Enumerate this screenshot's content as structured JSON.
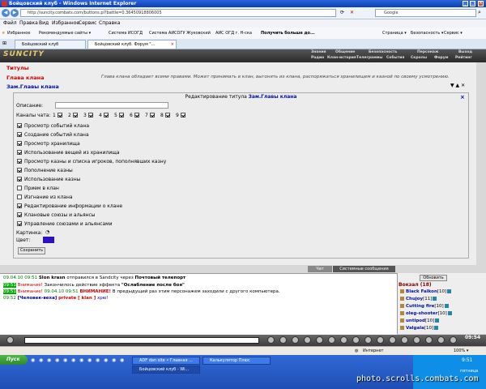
{
  "window": {
    "title": "Бойцовский клуб - Windows Internet Explorer"
  },
  "address": {
    "url": "http://suncity.combats.com/buttons.pl?battle=0.36450918806005",
    "search_engine": "Google"
  },
  "menu": [
    "Файл",
    "Правка",
    "Вид",
    "Избранное",
    "Сервис",
    "Справка"
  ],
  "favorites": [
    "Избранное",
    "Рекомендуемые сайты ▾",
    "Система ИСОГД",
    "Система АИСОГУ Жуковский",
    "АИС ОГД г. Н-ска",
    "Получить больше до..."
  ],
  "ie_tools": [
    "Страница ▾",
    "Безопасность ▾",
    "Сервис ▾"
  ],
  "tabs": [
    {
      "label": "Бойцовский клуб"
    },
    {
      "label": "Бойцовский клуб. Форум \"..."
    }
  ],
  "game": {
    "logo": "SUNCITY",
    "nav_top": [
      "Знания",
      "Общение",
      "Безопасность",
      "Персонаж",
      "Выход"
    ],
    "nav_bottom": [
      "Радио",
      "Клан-история",
      "Телеграммы",
      "События",
      "Скролы",
      "Форум",
      "Рейтинг"
    ]
  },
  "titles": {
    "section": "Титулы",
    "head_label": "Глава клана",
    "head_desc": "Глава клана обладает всеми правами. Может принимать в клан, выгонять из клана, распоряжаться хранилищем и казной по своему усмотрению.",
    "deputy_label": "Зам.Главы клана"
  },
  "editor": {
    "title_prefix": "Редактирование титула",
    "title_name": "Зам.Главы клана",
    "description_label": "Описание:",
    "channels_label": "Каналы чата:",
    "channels": [
      "1",
      "2",
      "3",
      "4",
      "5",
      "6",
      "7",
      "8",
      "9"
    ],
    "permissions": [
      {
        "label": "Просмотр событий клана",
        "checked": true
      },
      {
        "label": "Создание событий клана",
        "checked": true
      },
      {
        "label": "Просмотр хранилища",
        "checked": true
      },
      {
        "label": "Использование вещей из хранилища",
        "checked": true
      },
      {
        "label": "Просмотр казны и списка игроков, пополнявших казну",
        "checked": true
      },
      {
        "label": "Пополнение казны",
        "checked": true
      },
      {
        "label": "Использование казны",
        "checked": true
      },
      {
        "label": "Прием в клан",
        "checked": false
      },
      {
        "label": "Изгнание из клана",
        "checked": false
      },
      {
        "label": "Редактирование информации о клане",
        "checked": true
      },
      {
        "label": "Клановые союзы и альянсы",
        "checked": true
      },
      {
        "label": "Управление союзами и альянсами",
        "checked": true
      }
    ],
    "image_label": "Картинка:",
    "color_label": "Цвет:",
    "color_value": "#2c10c8",
    "save_label": "Сохранить"
  },
  "chat_tabs": [
    "Чат",
    "Системные сообщения"
  ],
  "chat": {
    "l1_time": "09.04.10 09:51",
    "l1_name": "Slon krasn",
    "l1_text1": "отправился в",
    "l1_city": "Sandcity",
    "l1_text2": "через",
    "l1_what": "Почтовый телепорт",
    "l2_time": "09:51",
    "l2_warn": "Внимание!",
    "l2_text": "Закончилось действие эффекта",
    "l2_effect": "\"Ослабление после боя\"",
    "l3_time": "09:51",
    "l3_warn": "Внимание!",
    "l3_warn2": "ВНИМАНИЕ!",
    "l3_text": "В предыдущий раз этим персонажем заходили с другого компьютера.",
    "l3_date": "09.04.10 09:51",
    "l4_time": "09:52",
    "l4_name": "[Человек-веха]",
    "l4_private": "private [ klan ]",
    "l4_text": "хрю!"
  },
  "online": {
    "refresh_label": "Обновить",
    "location": "Вокзал (18)",
    "players": [
      {
        "name": "Black Falkon",
        "level": "[10]"
      },
      {
        "name": "Chujoy",
        "level": "[11]"
      },
      {
        "name": "Cutting fire",
        "level": "[10]"
      },
      {
        "name": "oleg-shooter",
        "level": "[10]"
      },
      {
        "name": "untipod",
        "level": "[10]"
      },
      {
        "name": "Valgala",
        "level": "[10]"
      }
    ]
  },
  "game_clock": "09:54",
  "status": {
    "zone": "Интернет",
    "zoom": "100% ▾"
  },
  "taskbar": {
    "start": "Пуск",
    "tasks": [
      "ADF dan site • Главная ...",
      "Бойцовский клуб - Wi...",
      "Калькулятор Плюс"
    ],
    "clock": "9:51",
    "weekday": "пятница",
    "watermark": "photo.scrolls.combats.com"
  }
}
